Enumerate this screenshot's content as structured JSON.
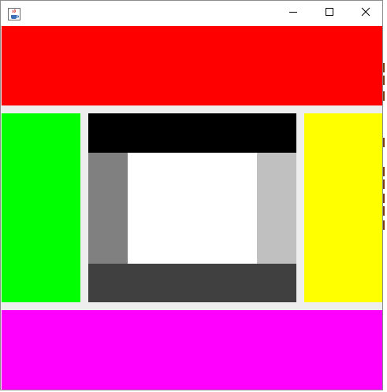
{
  "window": {
    "title": "",
    "icon": "java-cup-icon",
    "controls": {
      "minimize_icon": "minimize-icon",
      "maximize_icon": "maximize-icon",
      "close_icon": "close-icon"
    }
  },
  "panels": {
    "north": {
      "color": "#ff0000"
    },
    "west": {
      "color": "#00ff00"
    },
    "east": {
      "color": "#ffff00"
    },
    "south": {
      "color": "#ff00ff"
    },
    "center": {
      "top": {
        "color": "#000000"
      },
      "left": {
        "color": "#808080"
      },
      "middle": {
        "color": "#ffffff"
      },
      "right": {
        "color": "#c0c0c0"
      },
      "bottom": {
        "color": "#404040"
      }
    }
  },
  "background_color": "#eeeeee"
}
